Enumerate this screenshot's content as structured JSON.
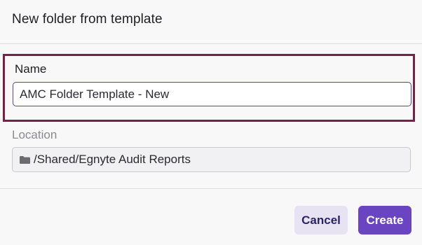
{
  "dialog": {
    "title": "New folder from template"
  },
  "name_field": {
    "label": "Name",
    "value": "AMC Folder Template - New"
  },
  "location_field": {
    "label": "Location",
    "value": "/Shared/Egnyte Audit Reports",
    "icon": "folder-icon"
  },
  "buttons": {
    "cancel_label": "Cancel",
    "create_label": "Create"
  },
  "colors": {
    "highlight_border": "#7a1f46",
    "primary": "#6a45c2",
    "secondary_bg": "#e7e3f3",
    "secondary_text": "#2b2466"
  }
}
